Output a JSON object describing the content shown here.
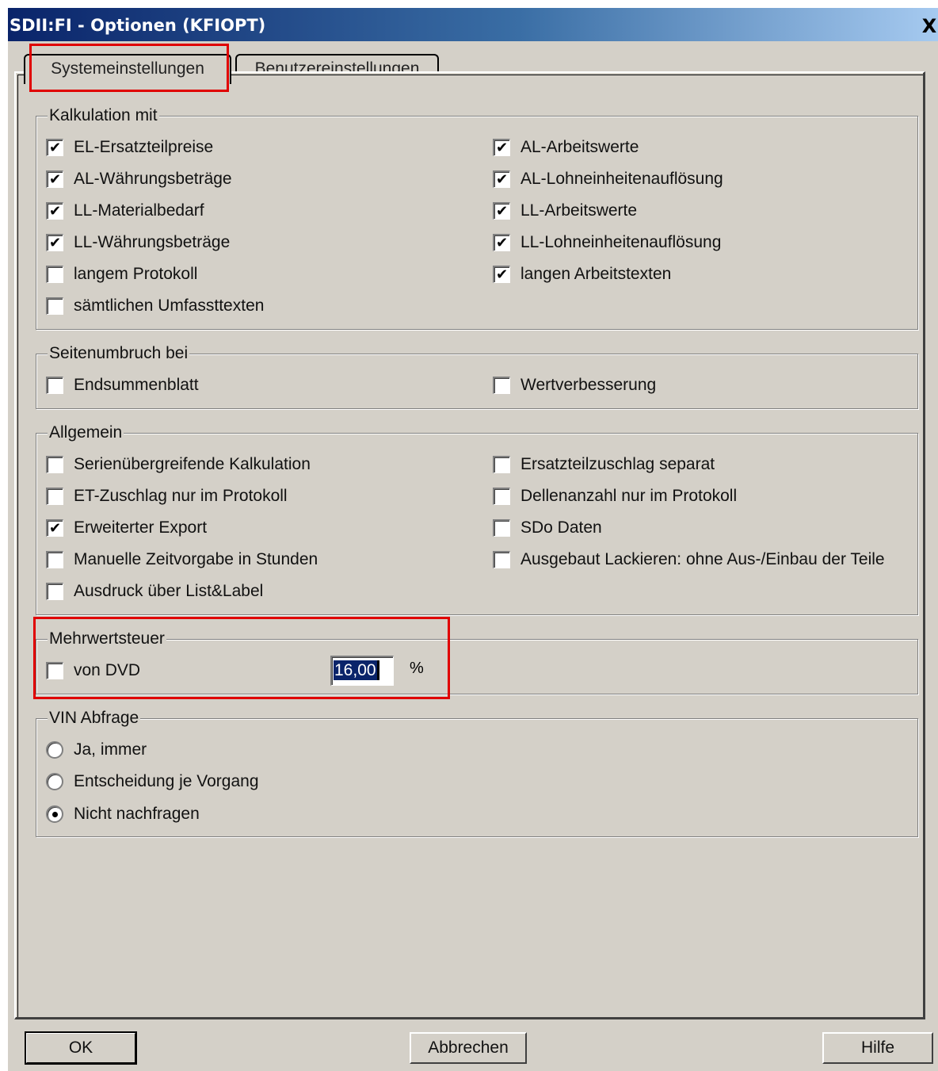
{
  "window": {
    "title": "SDII:FI - Optionen (KFIOPT)",
    "close_glyph": "X"
  },
  "tabs": [
    {
      "label": "Systemeinstellungen",
      "active": true
    },
    {
      "label": "Benutzereinstellungen",
      "active": false
    }
  ],
  "groups": {
    "kalkulation": {
      "label": "Kalkulation mit",
      "items": [
        {
          "label": "EL-Ersatzteilpreise",
          "checked": true
        },
        {
          "label": "AL-Währungsbeträge",
          "checked": true
        },
        {
          "label": "LL-Materialbedarf",
          "checked": true
        },
        {
          "label": "LL-Währungsbeträge",
          "checked": true
        },
        {
          "label": "langem Protokoll",
          "checked": false
        },
        {
          "label": "sämtlichen Umfassttexten",
          "checked": false
        },
        {
          "label": "AL-Arbeitswerte",
          "checked": true
        },
        {
          "label": "AL-Lohneinheitenauflösung",
          "checked": true
        },
        {
          "label": "LL-Arbeitswerte",
          "checked": true
        },
        {
          "label": "LL-Lohneinheitenauflösung",
          "checked": true
        },
        {
          "label": "langen Arbeitstexten",
          "checked": true
        }
      ]
    },
    "seitenumbruch": {
      "label": "Seitenumbruch bei",
      "items": [
        {
          "label": "Endsummenblatt",
          "checked": false
        },
        {
          "label": "Wertverbesserung",
          "checked": false
        }
      ]
    },
    "allgemein": {
      "label": "Allgemein",
      "items": [
        {
          "label": "Serienübergreifende Kalkulation",
          "checked": false
        },
        {
          "label": "ET-Zuschlag nur im Protokoll",
          "checked": false
        },
        {
          "label": "Erweiterter Export",
          "checked": true
        },
        {
          "label": "Manuelle Zeitvorgabe in Stunden",
          "checked": false
        },
        {
          "label": "Ausdruck über List&Label",
          "checked": false
        },
        {
          "label": "Ersatzteilzuschlag separat",
          "checked": false
        },
        {
          "label": "Dellenanzahl nur im Protokoll",
          "checked": false
        },
        {
          "label": "SDo Daten",
          "checked": false
        },
        {
          "label": "Ausgebaut Lackieren: ohne Aus-/Einbau der Teile",
          "checked": false
        }
      ]
    },
    "mwst": {
      "label": "Mehrwertsteuer",
      "von_dvd": {
        "label": "von DVD",
        "checked": false
      },
      "rate_value": "16,00",
      "unit": "%"
    },
    "vin": {
      "label": "VIN Abfrage",
      "options": [
        {
          "label": "Ja, immer",
          "selected": false
        },
        {
          "label": "Entscheidung je Vorgang",
          "selected": false
        },
        {
          "label": "Nicht nachfragen",
          "selected": true
        }
      ]
    }
  },
  "buttons": {
    "ok": "OK",
    "cancel": "Abbrechen",
    "help": "Hilfe"
  },
  "colors": {
    "highlight": "#e00000",
    "title_start": "#0a246a",
    "face": "#d4d0c8"
  },
  "check_glyph": "✔"
}
